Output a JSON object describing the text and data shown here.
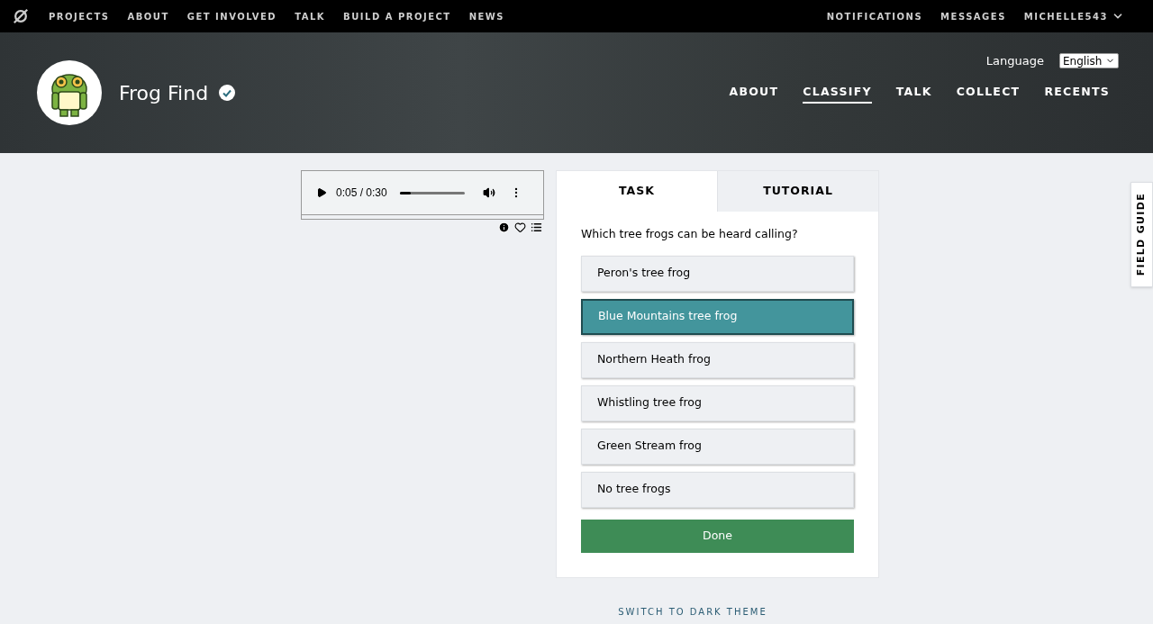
{
  "top_nav": {
    "links": [
      {
        "label": "PROJECTS"
      },
      {
        "label": "ABOUT"
      },
      {
        "label": "GET INVOLVED"
      },
      {
        "label": "TALK"
      },
      {
        "label": "BUILD A PROJECT"
      },
      {
        "label": "NEWS"
      }
    ],
    "right_links": [
      {
        "label": "NOTIFICATIONS"
      },
      {
        "label": "MESSAGES"
      }
    ],
    "user": "MICHELLE543"
  },
  "project": {
    "title": "Frog Find",
    "verified": true,
    "language_label": "Language",
    "language": "English",
    "tabs": [
      {
        "label": "ABOUT",
        "selected": false
      },
      {
        "label": "CLASSIFY",
        "selected": true
      },
      {
        "label": "TALK",
        "selected": false
      },
      {
        "label": "COLLECT",
        "selected": false
      },
      {
        "label": "RECENTS",
        "selected": false
      }
    ]
  },
  "audio": {
    "time": "0:05 / 0:30",
    "level": 0.17
  },
  "task_panel": {
    "tabs": [
      {
        "label": "TASK",
        "selected": true
      },
      {
        "label": "TUTORIAL",
        "selected": false
      }
    ],
    "question": "Which tree frogs can be heard calling?",
    "options": [
      {
        "label": "Peron's tree frog",
        "selected": false
      },
      {
        "label": "Blue Mountains tree frog",
        "selected": true
      },
      {
        "label": "Northern Heath frog",
        "selected": false
      },
      {
        "label": "Whistling tree frog",
        "selected": false
      },
      {
        "label": "Green Stream frog",
        "selected": false
      },
      {
        "label": "No tree frogs",
        "selected": false
      }
    ],
    "done": "Done"
  },
  "field_guide": "FIELD GUIDE",
  "theme_switch": "SWITCH TO DARK THEME"
}
